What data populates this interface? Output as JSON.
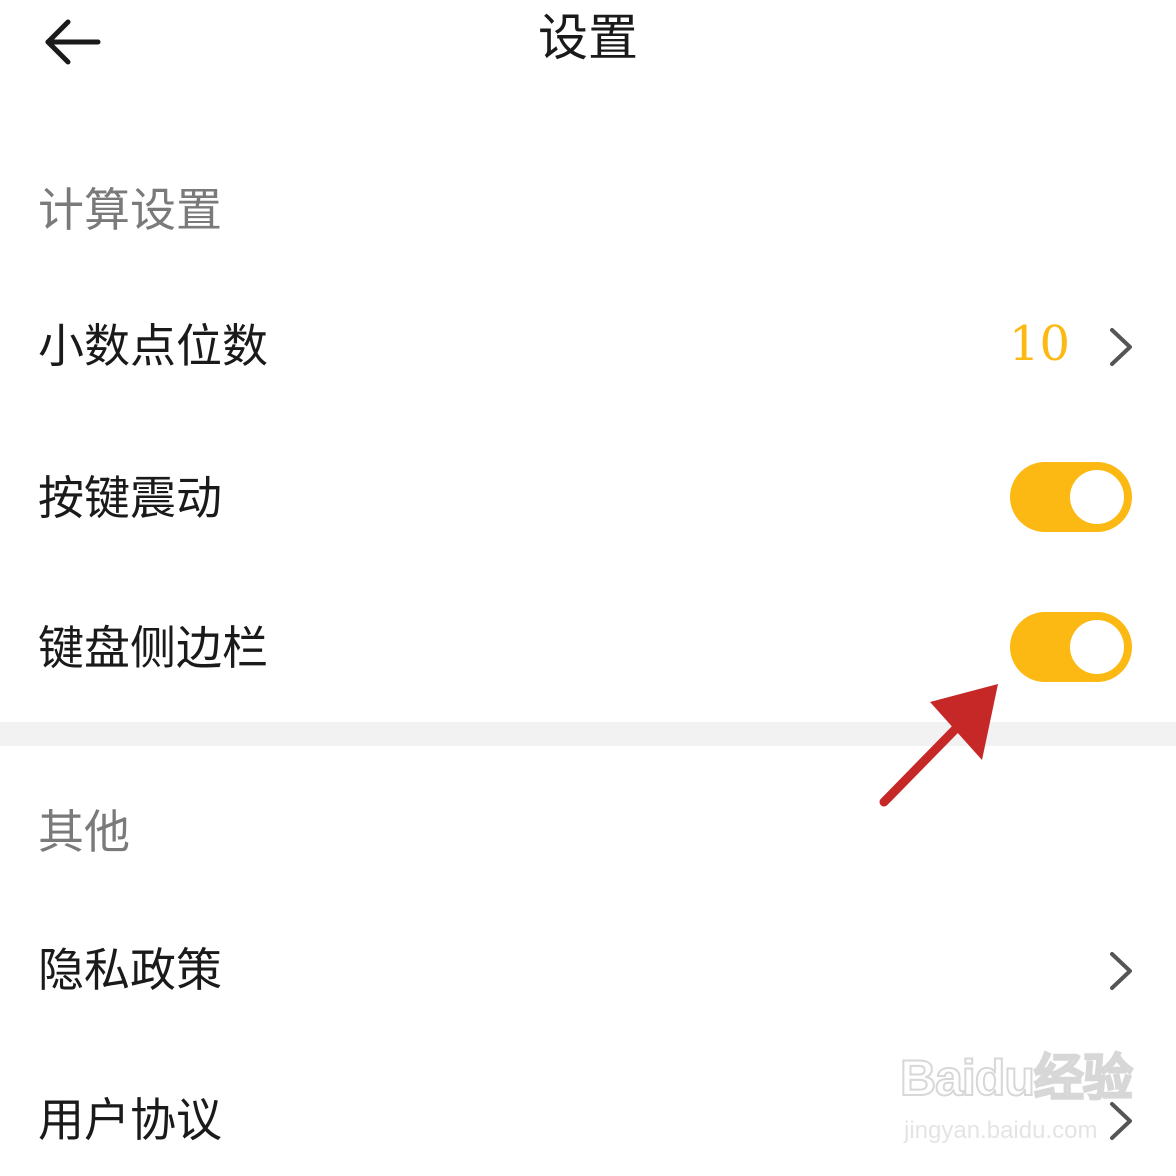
{
  "theme": {
    "accent": "#FDB913",
    "arrow_color": "#C62828",
    "text_primary": "#1a1a1a",
    "text_secondary": "#7a7a7a",
    "divider": "#f2f2f2"
  },
  "header": {
    "back_icon": "arrow-left-icon",
    "title": "设置"
  },
  "sections": [
    {
      "header": "计算设置",
      "rows": [
        {
          "label": "小数点位数",
          "value": "10",
          "control": "chevron"
        },
        {
          "label": "按键震动",
          "control": "toggle",
          "checked": true
        },
        {
          "label": "键盘侧边栏",
          "control": "toggle",
          "checked": true
        }
      ]
    },
    {
      "header": "其他",
      "rows": [
        {
          "label": "隐私政策",
          "control": "chevron"
        },
        {
          "label": "用户协议",
          "control": "chevron"
        }
      ]
    }
  ],
  "watermark": {
    "logo": "Baidu经验",
    "url": "jingyan.baidu.com"
  }
}
